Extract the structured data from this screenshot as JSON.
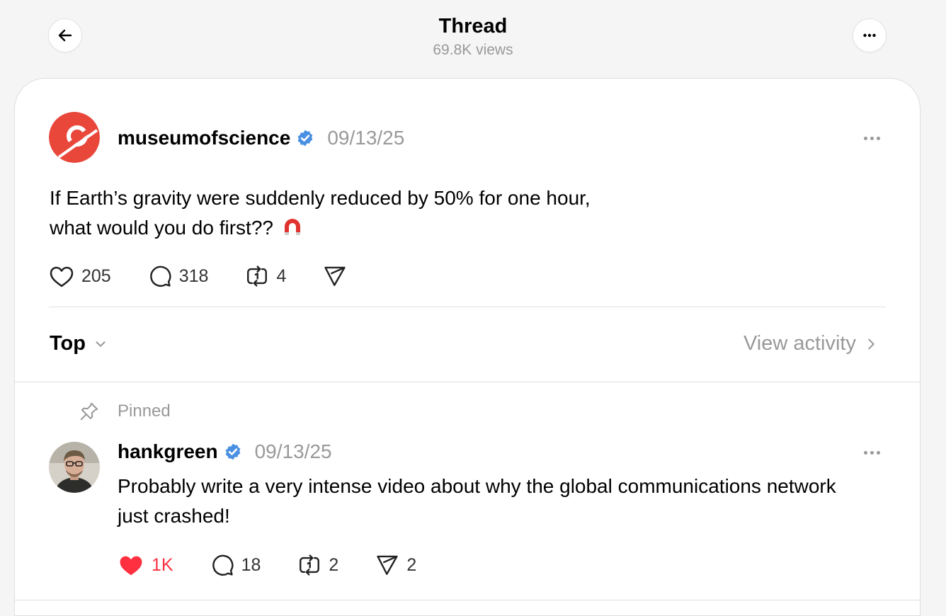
{
  "header": {
    "title": "Thread",
    "views": "69.8K views",
    "back_icon": "arrow-left-icon",
    "more_icon": "more-horizontal-icon"
  },
  "post": {
    "username": "museumofscience",
    "verified_icon": "verified-badge-icon",
    "date": "09/13/25",
    "text_line1": "If Earth’s gravity were suddenly reduced by 50% for one hour,",
    "text_line2": "what would you do first??",
    "emoji": "🧲",
    "likes": "205",
    "replies": "318",
    "reposts": "4",
    "accent_color": "#e8473a"
  },
  "sort": {
    "label": "Top",
    "view_activity": "View activity"
  },
  "reply": {
    "pinned_label": "Pinned",
    "username": "hankgreen",
    "date": "09/13/25",
    "text": "Probably write a very intense video about why the global communications network just crashed!",
    "likes": "1K",
    "replies": "18",
    "reposts": "2",
    "shares": "2",
    "liked": true,
    "like_color": "#ff3040"
  }
}
